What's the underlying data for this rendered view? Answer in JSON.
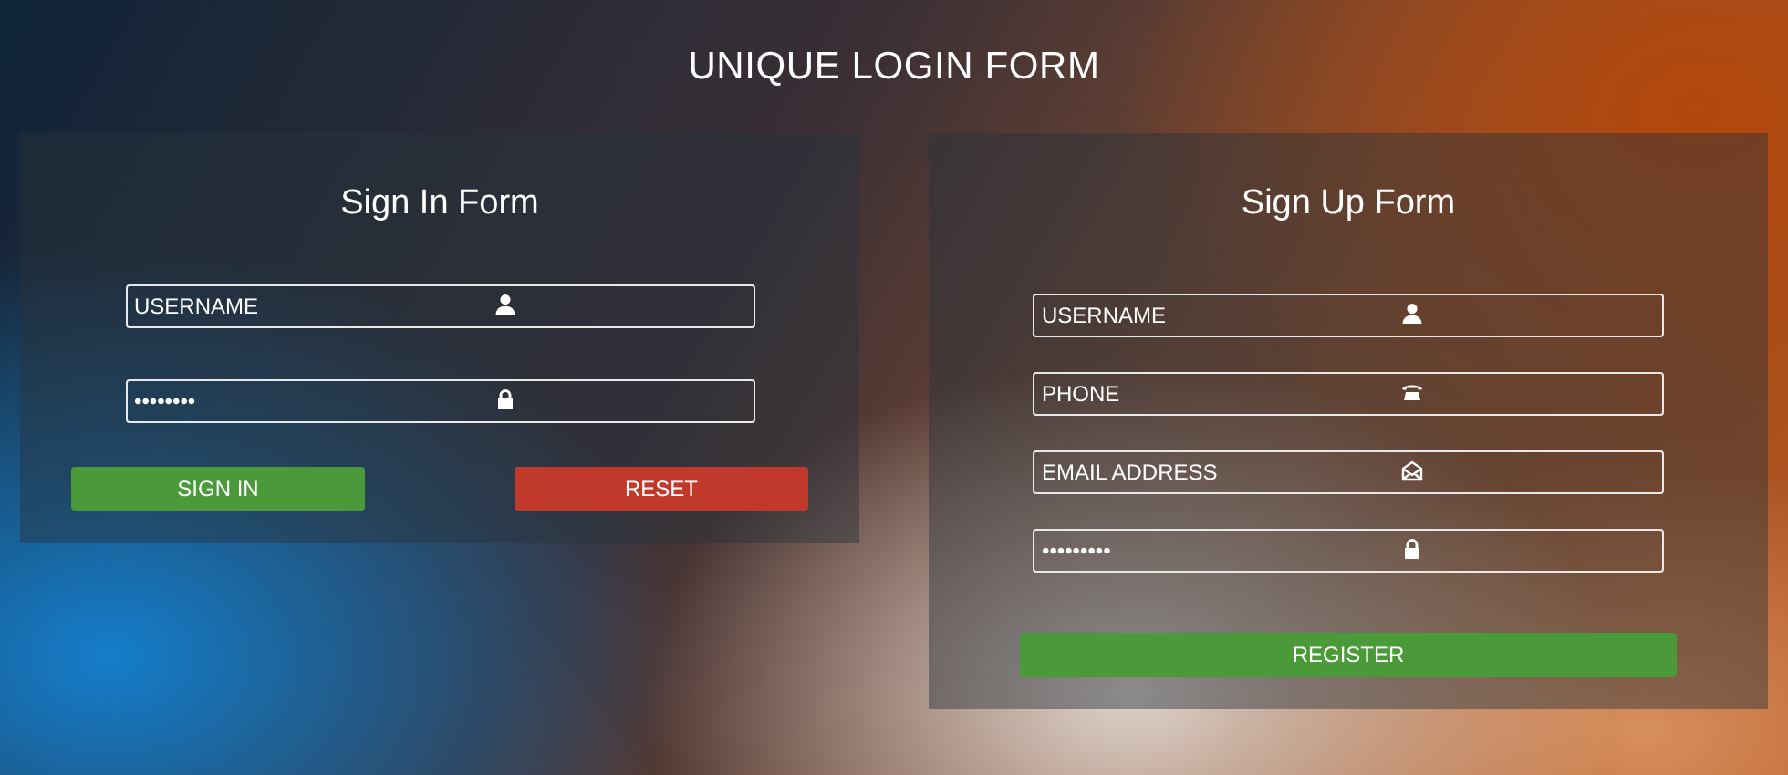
{
  "title": "UNIQUE LOGIN FORM",
  "sign_in": {
    "heading": "Sign In Form",
    "fields": [
      {
        "kind": "user",
        "value": "USERNAME"
      },
      {
        "kind": "lock",
        "value": "••••••••"
      }
    ],
    "buttons": [
      {
        "kind": "confirm",
        "label": "SIGN IN"
      },
      {
        "kind": "reset",
        "label": "RESET"
      }
    ]
  },
  "sign_up": {
    "heading": "Sign Up Form",
    "fields": [
      {
        "kind": "user",
        "value": "USERNAME"
      },
      {
        "kind": "phone",
        "value": "PHONE"
      },
      {
        "kind": "email",
        "value": "EMAIL ADDRESS"
      },
      {
        "kind": "lock",
        "value": "•••••••••"
      }
    ],
    "buttons": [
      {
        "kind": "confirm",
        "label": "REGISTER"
      }
    ]
  }
}
